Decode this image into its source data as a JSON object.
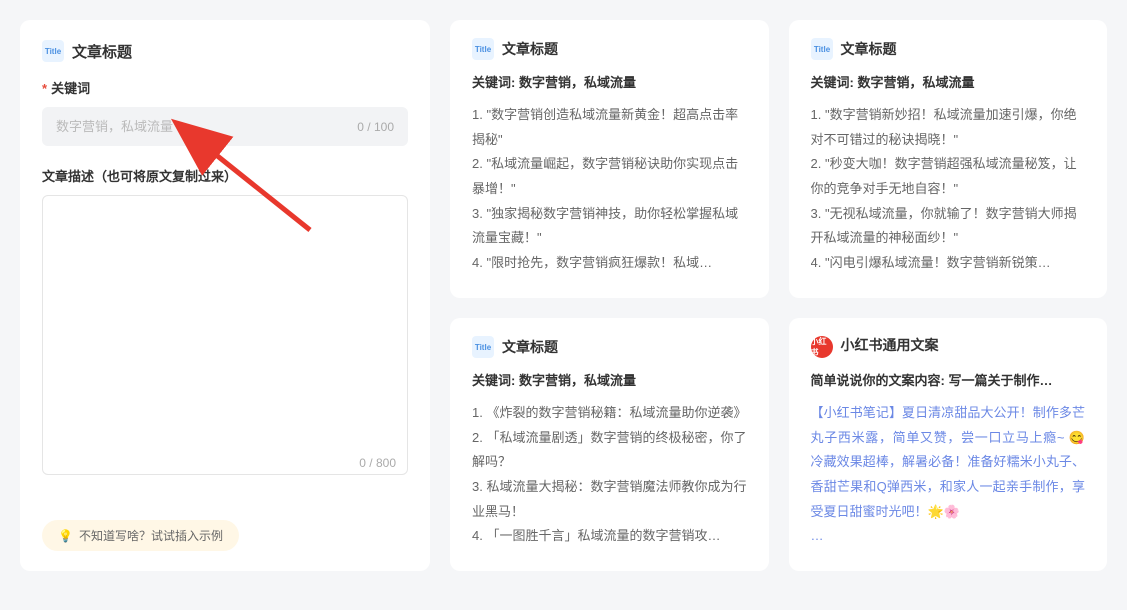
{
  "form": {
    "section_title": "文章标题",
    "keyword_label": "关键词",
    "keyword_placeholder": "数字营销，私域流量",
    "keyword_count": "0 / 100",
    "description_label": "文章描述（也可将原文复制过来）",
    "description_count": "0 / 800",
    "hint_text": "不知道写啥？试试插入示例"
  },
  "cards": [
    {
      "title": "文章标题",
      "keywords_label": "关键词: 数字营销，私域流量",
      "items": [
        "1. \"数字营销创造私域流量新黄金！超高点击率揭秘\"",
        "2. \"私域流量崛起，数字营销秘诀助你实现点击暴增！\"",
        "3. \"独家揭秘数字营销神技，助你轻松掌握私域流量宝藏！\"",
        "4. \"限时抢先，数字营销疯狂爆款！私域…"
      ]
    },
    {
      "title": "文章标题",
      "keywords_label": "关键词: 数字营销，私域流量",
      "items": [
        "1. \"数字营销新妙招！私域流量加速引爆，你绝对不可错过的秘诀揭晓！\"",
        "2. \"秒变大咖！数字营销超强私域流量秘笈，让你的竞争对手无地自容！\"",
        "3. \"无视私域流量，你就输了！数字营销大师揭开私域流量的神秘面纱！\"",
        "4. \"闪电引爆私域流量！数字营销新锐策…"
      ]
    },
    {
      "title": "文章标题",
      "keywords_label": "关键词: 数字营销，私域流量",
      "items": [
        "1. 《炸裂的数字营销秘籍：私域流量助你逆袭》",
        "2. 「私域流量剧透」数字营销的终极秘密，你了解吗？",
        "3. 私域流量大揭秘：数字营销魔法师教你成为行业黑马！",
        "4. 「一图胜千言」私域流量的数字营销攻…"
      ]
    }
  ],
  "xhs": {
    "title": "小红书通用文案",
    "subtitle": "简单说说你的文案内容: 写一篇关于制作…",
    "content": "【小红书笔记】夏日清凉甜品大公开！制作多芒丸子西米露，简单又赞，尝一口立马上瘾~ 😋 冷藏效果超棒，解暑必备！准备好糯米小丸子、香甜芒果和Q弹西米，和家人一起亲手制作，享受夏日甜蜜时光吧！🌟🌸",
    "more": "…"
  }
}
